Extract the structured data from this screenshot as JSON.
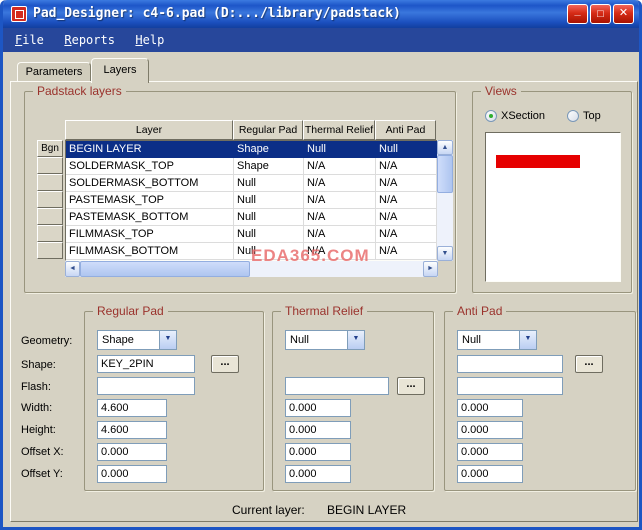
{
  "window": {
    "title": "Pad_Designer: c4-6.pad (D:.../library/padstack)",
    "controls": {
      "minimize": "_",
      "maximize": "□",
      "close": "✕"
    }
  },
  "menu": {
    "items": [
      "File",
      "Reports",
      "Help"
    ]
  },
  "tabs": {
    "parameters": "Parameters",
    "layers": "Layers"
  },
  "icons": {
    "dropdown_arrow": "▼",
    "scroll_up": "▲",
    "scroll_down": "▼",
    "scroll_left": "◄",
    "scroll_right": "►"
  },
  "padstack": {
    "group_title": "Padstack layers",
    "bgn_label": "Bgn",
    "columns": [
      "Layer",
      "Regular Pad",
      "Thermal Relief",
      "Anti Pad"
    ],
    "rows": [
      {
        "layer": "BEGIN LAYER",
        "regular": "Shape",
        "thermal": "Null",
        "anti": "Null"
      },
      {
        "layer": "SOLDERMASK_TOP",
        "regular": "Shape",
        "thermal": "N/A",
        "anti": "N/A"
      },
      {
        "layer": "SOLDERMASK_BOTTOM",
        "regular": "Null",
        "thermal": "N/A",
        "anti": "N/A"
      },
      {
        "layer": "PASTEMASK_TOP",
        "regular": "Null",
        "thermal": "N/A",
        "anti": "N/A"
      },
      {
        "layer": "PASTEMASK_BOTTOM",
        "regular": "Null",
        "thermal": "N/A",
        "anti": "N/A"
      },
      {
        "layer": "FILMMASK_TOP",
        "regular": "Null",
        "thermal": "N/A",
        "anti": "N/A"
      },
      {
        "layer": "FILMMASK_BOTTOM",
        "regular": "Null",
        "thermal": "N/A",
        "anti": "N/A"
      }
    ],
    "watermark": "EDA365.COM"
  },
  "views": {
    "group_title": "Views",
    "xsection_label": "XSection",
    "top_label": "Top"
  },
  "field_labels": {
    "geometry": "Geometry:",
    "shape": "Shape:",
    "flash": "Flash:",
    "width": "Width:",
    "height": "Height:",
    "offset_x": "Offset X:",
    "offset_y": "Offset Y:"
  },
  "regular_pad": {
    "group_title": "Regular Pad",
    "geometry_value": "Shape",
    "shape_value": "KEY_2PIN",
    "flash_value": "",
    "width_value": "4.600",
    "height_value": "4.600",
    "offset_x_value": "0.000",
    "offset_y_value": "0.000",
    "browse_label": "..."
  },
  "thermal_relief": {
    "group_title": "Thermal Relief",
    "geometry_value": "Null",
    "flash_value": "",
    "width_value": "0.000",
    "height_value": "0.000",
    "offset_x_value": "0.000",
    "offset_y_value": "0.000",
    "browse_label": "..."
  },
  "anti_pad": {
    "group_title": "Anti Pad",
    "geometry_value": "Null",
    "shape_value": "",
    "flash_value": "",
    "width_value": "0.000",
    "height_value": "0.000",
    "offset_x_value": "0.000",
    "offset_y_value": "0.000",
    "browse_label": "..."
  },
  "footer": {
    "current_layer_label": "Current layer:",
    "current_layer_value": "BEGIN LAYER"
  },
  "colors": {
    "titlebar_blue": "#1d55c8",
    "menubar_blue": "#27479b",
    "selection_blue": "#0b2e87",
    "group_title_maroon": "#9a322c",
    "xsection_red": "#e60000",
    "watermark_pink": "#e96e6e"
  }
}
